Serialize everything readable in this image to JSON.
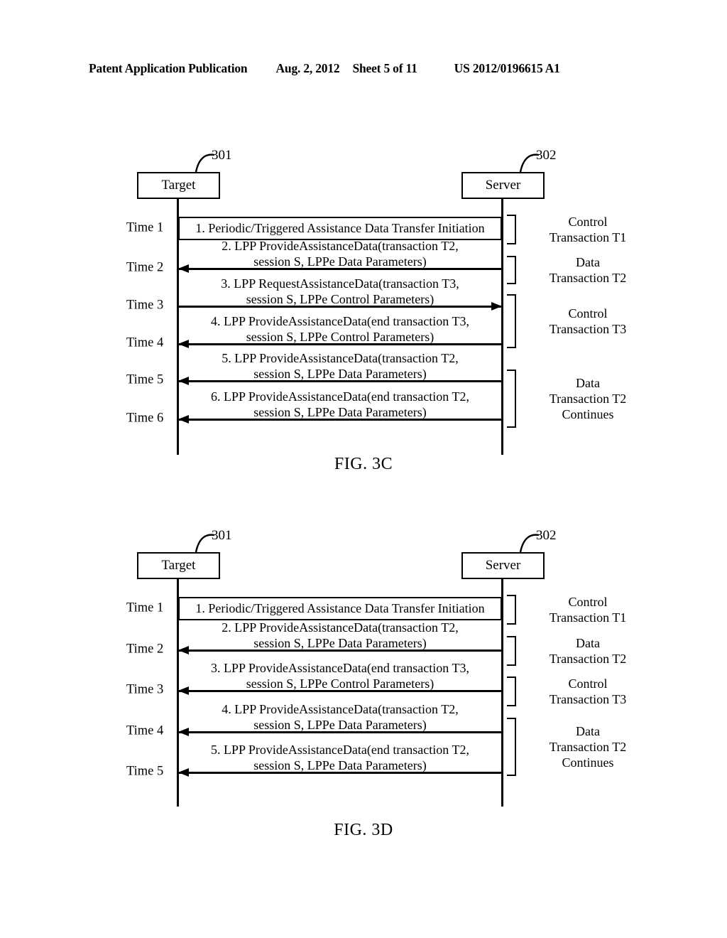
{
  "header": {
    "publication": "Patent Application Publication",
    "date": "Aug. 2, 2012",
    "sheet": "Sheet 5 of 11",
    "patent_number": "US 2012/0196615 A1"
  },
  "figures": [
    {
      "id": "3c",
      "caption": "FIG. 3C",
      "nodes": {
        "target": {
          "label": "Target",
          "ref": "301"
        },
        "server": {
          "label": "Server",
          "ref": "302"
        }
      },
      "rows": [
        {
          "time": "Time 1",
          "style": "box",
          "direction": "none",
          "line1": "1. Periodic/Triggered Assistance Data Transfer Initiation",
          "line2": ""
        },
        {
          "time": "Time 2",
          "style": "arrow",
          "direction": "left",
          "line1": "2. LPP ProvideAssistanceData(transaction T2,",
          "line2": "session S, LPPe Data Parameters)"
        },
        {
          "time": "Time 3",
          "style": "arrow",
          "direction": "right",
          "line1": "3. LPP RequestAssistanceData(transaction T3,",
          "line2": "session S, LPPe Control Parameters)"
        },
        {
          "time": "Time 4",
          "style": "arrow",
          "direction": "left",
          "line1": "4. LPP ProvideAssistanceData(end transaction T3,",
          "line2": "session S, LPPe Control Parameters)"
        },
        {
          "time": "Time 5",
          "style": "arrow",
          "direction": "left",
          "line1": "5. LPP ProvideAssistanceData(transaction T2,",
          "line2": "session S, LPPe Data Parameters)"
        },
        {
          "time": "Time 6",
          "style": "arrow",
          "direction": "left",
          "line1": "6. LPP ProvideAssistanceData(end transaction T2,",
          "line2": "session S, LPPe Data Parameters)"
        }
      ],
      "brackets": [
        {
          "line1": "Control",
          "line2": "Transaction T1",
          "line3": ""
        },
        {
          "line1": "Data",
          "line2": "Transaction T2",
          "line3": ""
        },
        {
          "line1": "Control",
          "line2": "Transaction T3",
          "line3": ""
        },
        {
          "line1": "Data",
          "line2": "Transaction T2",
          "line3": "Continues"
        }
      ]
    },
    {
      "id": "3d",
      "caption": "FIG. 3D",
      "nodes": {
        "target": {
          "label": "Target",
          "ref": "301"
        },
        "server": {
          "label": "Server",
          "ref": "302"
        }
      },
      "rows": [
        {
          "time": "Time 1",
          "style": "box",
          "direction": "none",
          "line1": "1. Periodic/Triggered Assistance Data Transfer Initiation",
          "line2": ""
        },
        {
          "time": "Time 2",
          "style": "arrow",
          "direction": "left",
          "line1": "2. LPP ProvideAssistanceData(transaction T2,",
          "line2": "session S, LPPe Data Parameters)"
        },
        {
          "time": "Time 3",
          "style": "arrow",
          "direction": "left",
          "line1": "3. LPP ProvideAssistanceData(end transaction T3,",
          "line2": "session S, LPPe Control Parameters)"
        },
        {
          "time": "Time 4",
          "style": "arrow",
          "direction": "left",
          "line1": "4. LPP ProvideAssistanceData(transaction T2,",
          "line2": "session S, LPPe Data Parameters)"
        },
        {
          "time": "Time 5",
          "style": "arrow",
          "direction": "left",
          "line1": "5. LPP ProvideAssistanceData(end transaction T2,",
          "line2": "session S, LPPe Data Parameters)"
        }
      ],
      "brackets": [
        {
          "line1": "Control",
          "line2": "Transaction T1",
          "line3": ""
        },
        {
          "line1": "Data",
          "line2": "Transaction T2",
          "line3": ""
        },
        {
          "line1": "Control",
          "line2": "Transaction T3",
          "line3": ""
        },
        {
          "line1": "Data",
          "line2": "Transaction T2",
          "line3": "Continues"
        }
      ]
    }
  ]
}
